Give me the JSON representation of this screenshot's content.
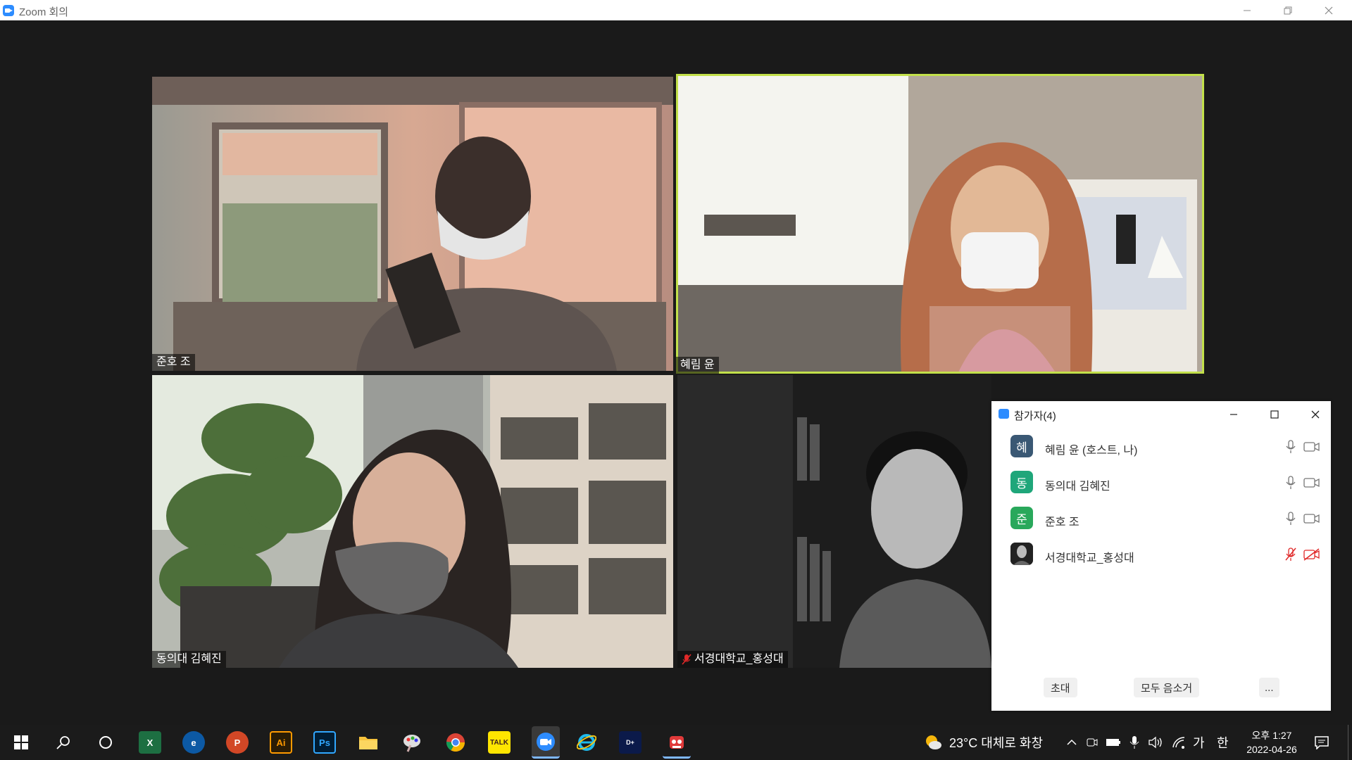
{
  "window": {
    "title": "Zoom 회의"
  },
  "tiles": [
    {
      "name": "준호 조"
    },
    {
      "name": "혜림 윤"
    },
    {
      "name": "동의대 김혜진"
    },
    {
      "name": "서경대학교_홍성대"
    }
  ],
  "participants_panel": {
    "title": "참가자(4)",
    "participants": [
      {
        "initial": "혜",
        "name": "혜림 윤 (호스트, 나)",
        "color": "#3a5874",
        "muted": false
      },
      {
        "initial": "동",
        "name": "동의대 김혜진",
        "color": "#1fa67a",
        "muted": false
      },
      {
        "initial": "준",
        "name": "준호 조",
        "color": "#29a85b",
        "muted": false
      },
      {
        "initial": "",
        "name": "서경대학교_홍성대",
        "color": "#222222",
        "muted": true
      }
    ],
    "buttons": {
      "invite": "초대",
      "mute_all": "모두 음소거",
      "more": "..."
    }
  },
  "taskbar": {
    "weather_text": "23°C  대체로 화창",
    "ime_language": "가",
    "ime_mode": "한",
    "clock_time": "오후 1:27",
    "clock_date": "2022-04-26"
  },
  "colors": {
    "active_speaker": "#c2e04a",
    "zoom_blue": "#2d8cff",
    "muted_red": "#e02828"
  }
}
